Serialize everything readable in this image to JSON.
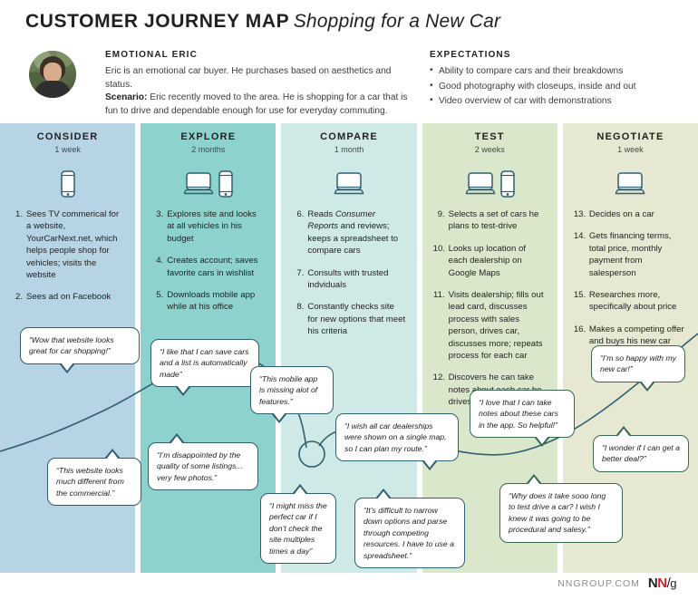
{
  "header": {
    "title_main": "CUSTOMER JOURNEY MAP",
    "title_sub": "Shopping for a New Car",
    "persona": {
      "heading": "EMOTIONAL ERIC",
      "line1": "Eric is an emotional car buyer. He purchases based on aesthetics and status.",
      "scenario_label": "Scenario:",
      "scenario_text": " Eric recently moved to the area. He is shopping for a car that is fun to drive and dependable enough for use for everyday commuting."
    },
    "expectations": {
      "heading": "EXPECTATIONS",
      "items": [
        "Ability to compare cars and their breakdowns",
        "Good photography with closeups, inside and out",
        "Video overview of car with demonstrations"
      ]
    }
  },
  "stages": [
    {
      "title": "CONSIDER",
      "duration": "1 week",
      "color": "#b6d4e4",
      "devices": [
        "phone"
      ],
      "steps": [
        {
          "num": "1.",
          "text": "Sees TV commerical for a website, YourCarNext.net, which helps people shop for vehicles; visits the website"
        },
        {
          "num": "2.",
          "text": "Sees ad on Facebook"
        }
      ]
    },
    {
      "title": "EXPLORE",
      "duration": "2 months",
      "color": "#8ed2cd",
      "devices": [
        "laptop",
        "phone"
      ],
      "steps": [
        {
          "num": "3.",
          "text": "Explores site and looks at all vehicles in his budget"
        },
        {
          "num": "4.",
          "text": "Creates account; saves favorite cars in wishlist"
        },
        {
          "num": "5.",
          "text": "Downloads mobile app while at his office"
        }
      ]
    },
    {
      "title": "COMPARE",
      "duration": "1 month",
      "color": "#cfe9e6",
      "devices": [
        "laptop"
      ],
      "steps": [
        {
          "num": "6.",
          "text": "Reads ",
          "italic": "Consumer Reports",
          "text2": " and reviews; keeps a spreadsheet to compare cars"
        },
        {
          "num": "7.",
          "text": "Consults with trusted indviduals"
        },
        {
          "num": "8.",
          "text": "Constantly checks site for new options that meet his criteria"
        }
      ]
    },
    {
      "title": "TEST",
      "duration": "2 weeks",
      "color": "#dbe7cb",
      "devices": [
        "laptop",
        "phone"
      ],
      "steps": [
        {
          "num": "9.",
          "text": "Selects a set of cars he plans to test-drive"
        },
        {
          "num": "10.",
          "text": "Looks up location of each dealership on Google Maps"
        },
        {
          "num": "11.",
          "text": "Visits dealership; fills out lead card, discusses process with sales person, drives car, discusses more; repeats process for each car"
        },
        {
          "num": "12.",
          "text": "Discovers he can take notes about each car he drives in the app"
        }
      ]
    },
    {
      "title": "NEGOTIATE",
      "duration": "1 week",
      "color": "#e7e8d2",
      "devices": [
        "laptop"
      ],
      "steps": [
        {
          "num": "13.",
          "text": "Decides on a car"
        },
        {
          "num": "14.",
          "text": "Gets financing terms, total price, monthly payment from salesperson"
        },
        {
          "num": "15.",
          "text": "Researches more, specifically about price"
        },
        {
          "num": "16.",
          "text": "Makes a competing offer and buys his new car"
        }
      ]
    }
  ],
  "quotes": [
    {
      "id": "q1",
      "text": "“Wow that website looks great for car shopping!”"
    },
    {
      "id": "q2",
      "text": "“I like that I can save cars and a list is automatically made”"
    },
    {
      "id": "q3",
      "text": "“This mobile app is missing alot of features.”"
    },
    {
      "id": "q4",
      "text": "“I wish all car dealerships were shown on a single map, so I can plan my route.”"
    },
    {
      "id": "q5",
      "text": "“I love that I can take notes about these cars in the app. So helpful!”"
    },
    {
      "id": "q6",
      "text": "“I’m so happy with my new car!”"
    },
    {
      "id": "q7",
      "text": "“I wonder if I can get a better deal?”"
    },
    {
      "id": "q8",
      "text": "“This website looks much different from the commercial.”"
    },
    {
      "id": "q9",
      "text": "“I’m disappointed by the quality of some listings... very few photos.”"
    },
    {
      "id": "q10",
      "text": "“I might miss the perfect car if I don’t check the site multiples times a day”"
    },
    {
      "id": "q11",
      "text": "“It’s difficult to narrow down options and parse through competing resources. I have to use a spreadsheet.”"
    },
    {
      "id": "q12",
      "text": "“Why does it take sooo long to test drive a car? I wish I knew it was going to be procedural and salesy.”"
    }
  ],
  "footer": {
    "url": "NNGROUP.COM",
    "logo_n1": "N",
    "logo_n2": "N",
    "logo_slash": "/",
    "logo_g": "g"
  },
  "colors": {
    "emotion_line": "#2f5f72",
    "accent_red": "#d2232a"
  }
}
